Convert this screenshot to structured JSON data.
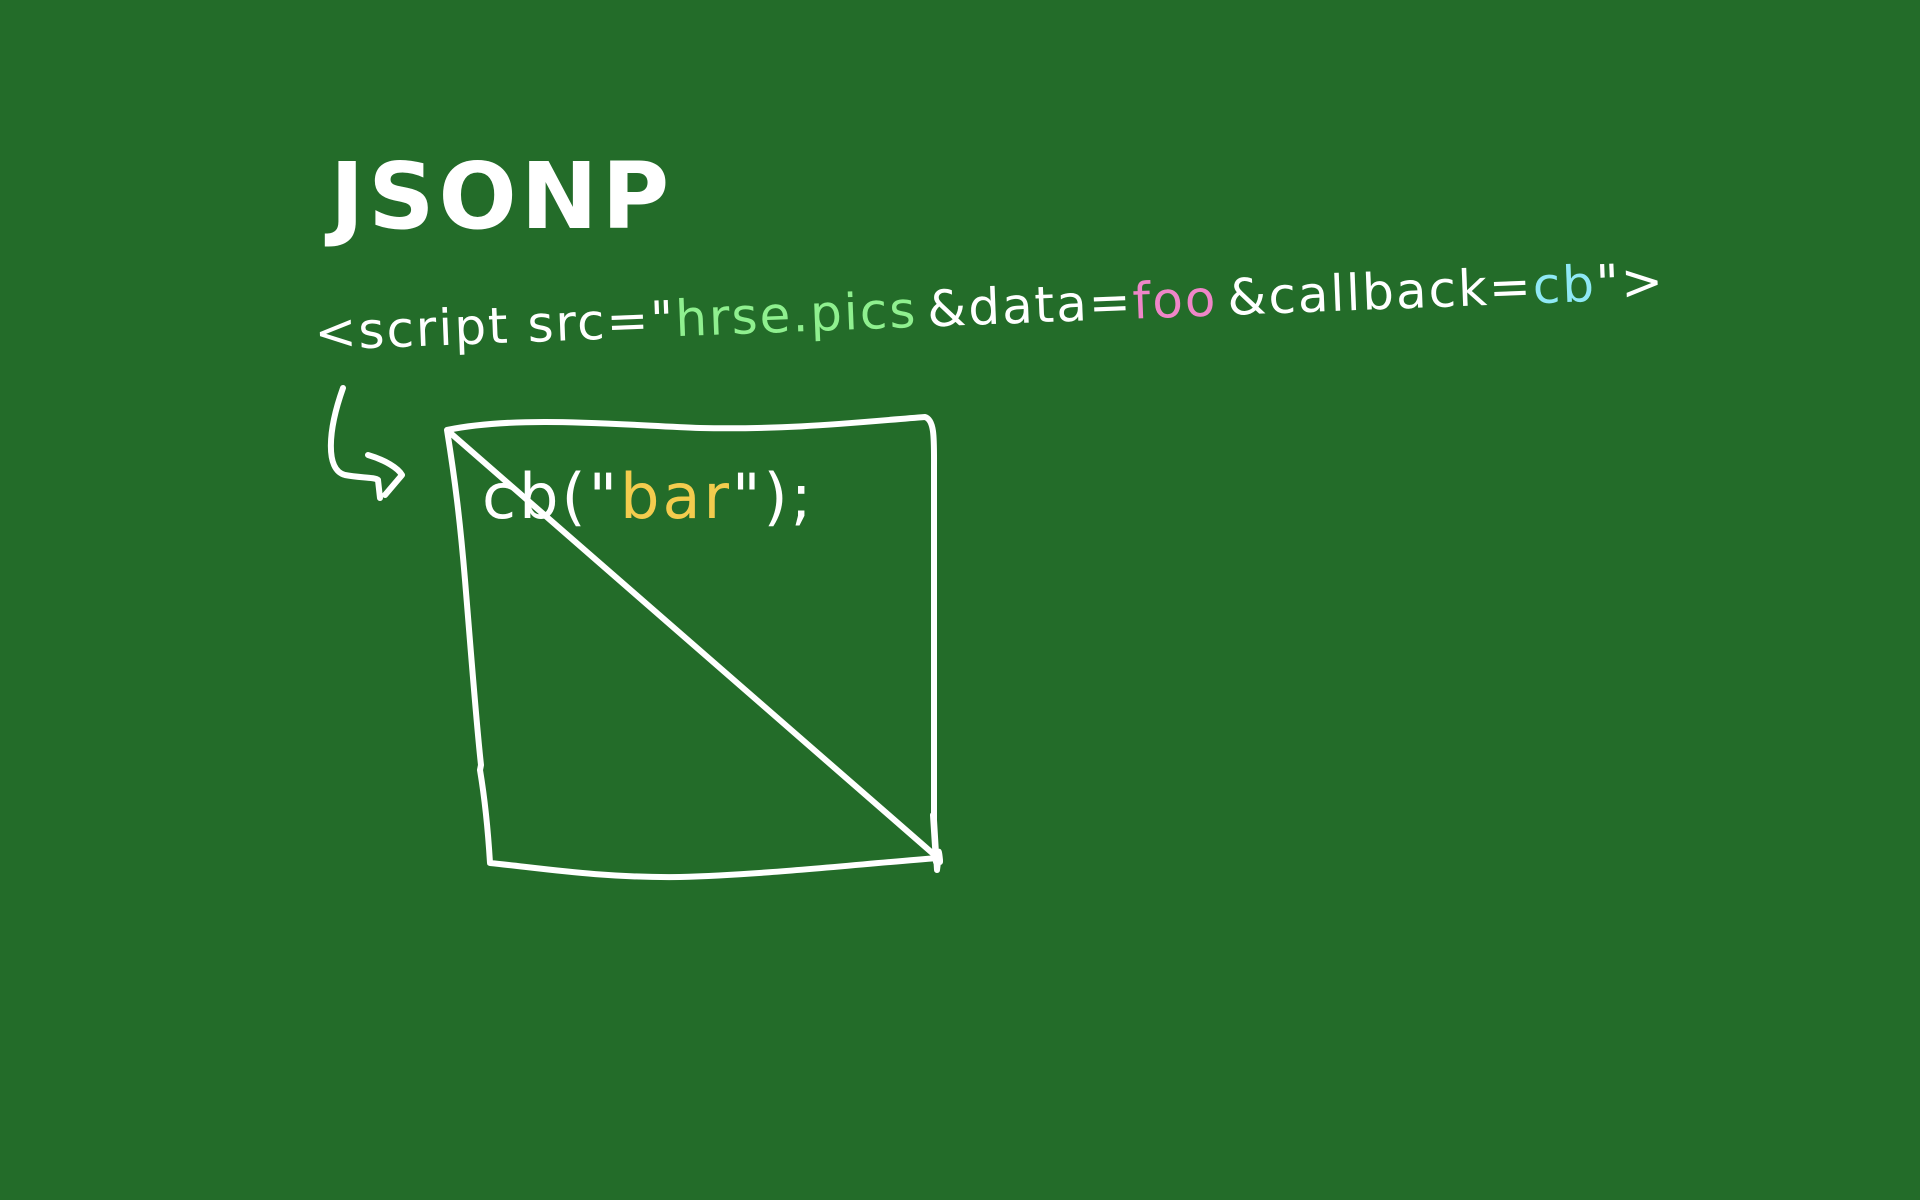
{
  "title": "JSONP",
  "script_tag": {
    "open": "<script src=\"",
    "host": "hrse.pics",
    "amp1": "&",
    "data_key": "data=",
    "data_value": "foo",
    "amp2": "&",
    "callback_key": "callback=",
    "callback_value": "cb",
    "close": "\">"
  },
  "response": {
    "prefix": "cb(\"",
    "value": "bar",
    "suffix": "\");"
  },
  "colors": {
    "background": "#236c29",
    "chalk": "#ffffff",
    "host": "#8ff08f",
    "data_value": "#ef86c8",
    "callback_value": "#8fe9f5",
    "response_value": "#f3cc4e"
  }
}
